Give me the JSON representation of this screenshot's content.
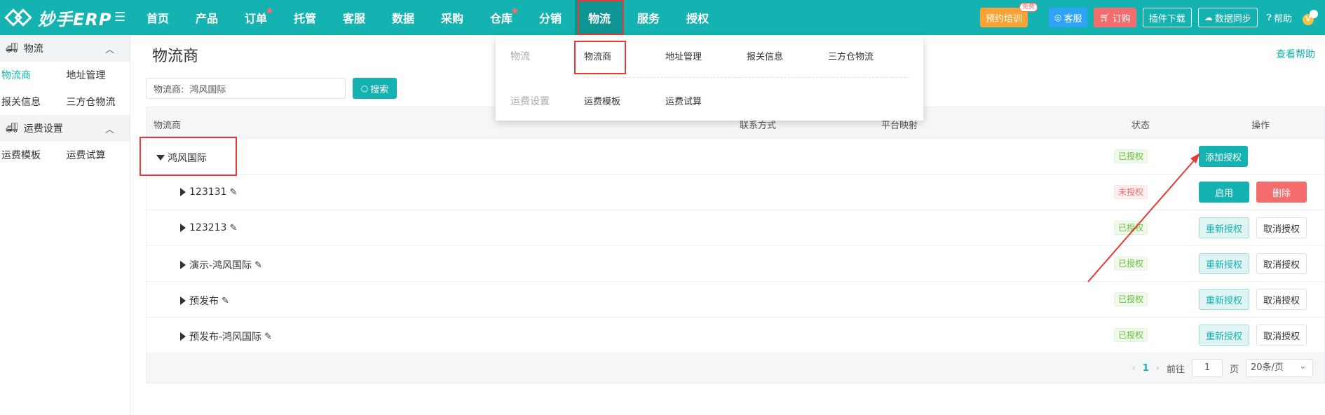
{
  "brand": {
    "logo_text": "妙手ERP"
  },
  "nav": {
    "items": [
      {
        "label": "首页"
      },
      {
        "label": "产品"
      },
      {
        "label": "订单"
      },
      {
        "label": "托管"
      },
      {
        "label": "客服"
      },
      {
        "label": "数据"
      },
      {
        "label": "采购"
      },
      {
        "label": "仓库"
      },
      {
        "label": "分销"
      },
      {
        "label": "物流"
      },
      {
        "label": "服务"
      },
      {
        "label": "授权"
      }
    ]
  },
  "tools": {
    "training": "预约培训",
    "free_badge": "免费",
    "support": "客服",
    "order": "订购",
    "plugin": "插件下载",
    "sync": "数据同步",
    "help": "帮助",
    "avatar_letter": "V"
  },
  "sidebar": {
    "group1": "物流",
    "group1_items": [
      "物流商",
      "地址管理",
      "报关信息",
      "三方仓物流"
    ],
    "group2": "运费设置",
    "group2_items": [
      "运费模板",
      "运费试算"
    ]
  },
  "page": {
    "title": "物流商",
    "help": "查看帮助",
    "filter_label": "物流商:",
    "filter_value": "鸿风国际",
    "search": "搜索"
  },
  "table": {
    "headers": {
      "provider": "物流商",
      "contact": "联系方式",
      "platform": "平台映射",
      "status": "状态",
      "action": "操作"
    },
    "parent": {
      "name": "鸿风国际",
      "status": "已授权",
      "action": "添加授权"
    },
    "rows": [
      {
        "name": "123131",
        "status": "未授权",
        "btn1": "启用",
        "btn2": "删除"
      },
      {
        "name": "123213",
        "status": "已授权",
        "btn1": "重新授权",
        "btn2": "取消授权"
      },
      {
        "name": "演示-鸿风国际",
        "status": "已授权",
        "btn1": "重新授权",
        "btn2": "取消授权"
      },
      {
        "name": "预发布",
        "status": "已授权",
        "btn1": "重新授权",
        "btn2": "取消授权"
      },
      {
        "name": "预发布-鸿风国际",
        "status": "已授权",
        "btn1": "重新授权",
        "btn2": "取消授权"
      }
    ]
  },
  "pager": {
    "current": "1",
    "goto": "前往",
    "page_input": "1",
    "page_unit": "页",
    "page_size": "20条/页"
  },
  "dropdown": {
    "cat1": "物流",
    "cat1_links": [
      "物流商",
      "地址管理",
      "报关信息",
      "三方仓物流"
    ],
    "cat2": "运费设置",
    "cat2_links": [
      "运费模板",
      "运费试算"
    ]
  },
  "colors": {
    "primary": "#14b2b0",
    "danger": "#f56c6c",
    "annotation": "#e53935"
  }
}
